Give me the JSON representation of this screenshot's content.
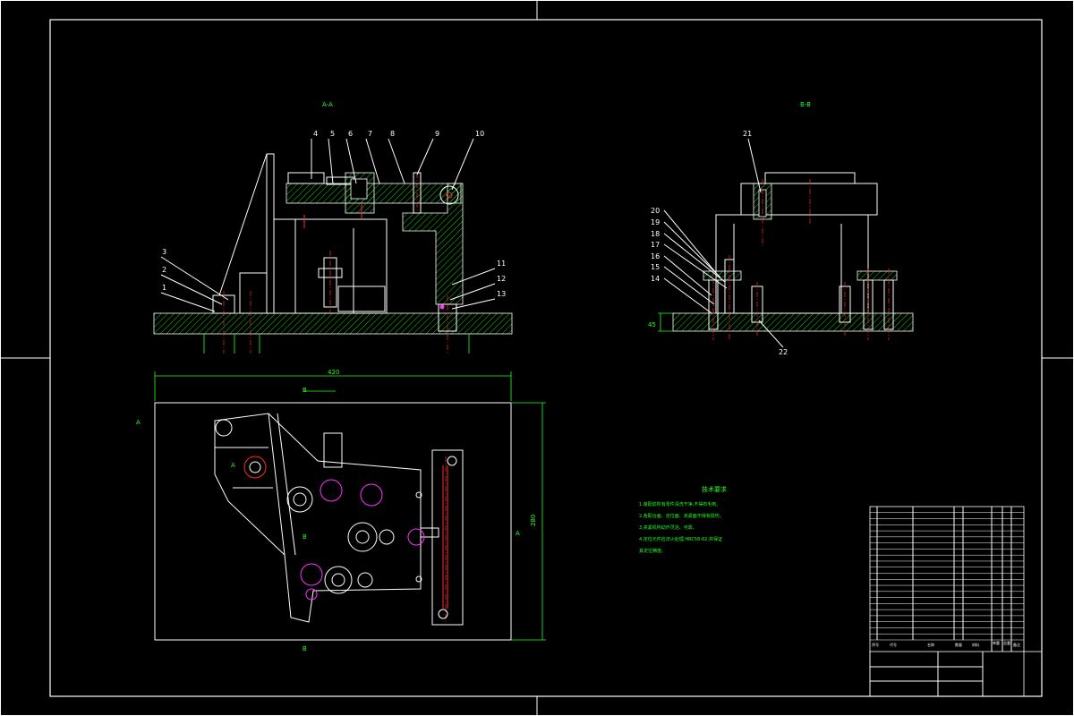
{
  "views": {
    "section_aa": "A-A",
    "section_bb": "B-B",
    "plan_marker_a_left": "A",
    "plan_marker_a_top": "A",
    "plan_marker_a_right": "A",
    "plan_marker_b_top": "B",
    "plan_marker_b_bottom": "B",
    "plan_marker_b_mid": "B"
  },
  "dimensions": {
    "plan_width": "420",
    "plan_height": "280",
    "bb_height": "45"
  },
  "part_callouts_aa": [
    "4",
    "5",
    "6",
    "7",
    "8",
    "9",
    "10",
    "3",
    "2",
    "1",
    "11",
    "12",
    "13"
  ],
  "part_callouts_bb": [
    "21",
    "20",
    "19",
    "18",
    "17",
    "16",
    "15",
    "14",
    "22"
  ],
  "technical_notes": {
    "title": "技术要求",
    "lines": [
      "1.装配前所有零件清洗干净,不得有毛刺。",
      "2.各配合面、定位面、夹紧面不得有损伤。",
      "3.夹紧机构动作灵活、可靠。",
      "4.定位元件应淬火处理,HRC58-62,并保证",
      "其定位精度。"
    ]
  },
  "title_block": {
    "rows": 22,
    "header_cells": [
      "序号",
      "代号",
      "名称",
      "数量",
      "材料",
      "单重",
      "总重",
      "备注"
    ]
  }
}
